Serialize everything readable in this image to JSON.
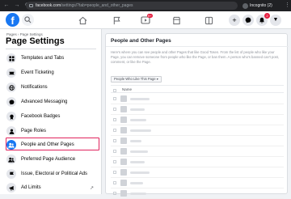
{
  "browser": {
    "url_domain": "facebook.com",
    "url_path": "/settings/?tab=people_and_other_pages",
    "profile_label": "Incognito (2)",
    "back_icon": "arrow-left-icon",
    "forward_icon": "arrow-right-icon",
    "reload_icon": "reload-icon"
  },
  "fb_header": {
    "logo": "f",
    "nav_badge": "9+",
    "plus_icon": "+",
    "messenger_badge": "",
    "notif_badge": "2",
    "accent": "#1877f2"
  },
  "sidebar": {
    "breadcrumb": "Pages › Page Settings",
    "title": "Page Settings",
    "items": [
      {
        "label": "Templates and Tabs",
        "icon": "grid-icon"
      },
      {
        "label": "Event Ticketing",
        "icon": "ticket-icon"
      },
      {
        "label": "Notifications",
        "icon": "globe-icon"
      },
      {
        "label": "Advanced Messaging",
        "icon": "messenger-icon"
      },
      {
        "label": "Facebook Badges",
        "icon": "badge-icon"
      },
      {
        "label": "Page Roles",
        "icon": "user-icon"
      },
      {
        "label": "People and Other Pages",
        "icon": "people-icon"
      },
      {
        "label": "Preferred Page Audience",
        "icon": "users-icon"
      },
      {
        "label": "Issue, Electoral or Political Ads",
        "icon": "flag-icon"
      },
      {
        "label": "Ad Limits",
        "icon": "megaphone-icon"
      }
    ],
    "active_index": 6
  },
  "main": {
    "title": "People and Other Pages",
    "description": "Here's where you can see people and other Pages that like Good Tosen. From the list of people who like your Page, you can remove someone from people who like the Page, or ban them. A person who's banned can't post, comment, or like the Page.",
    "filter_label": "People Who Like This Page ▾",
    "column_name": "Name",
    "rows": [
      {
        "name_hidden": ""
      },
      {
        "name_hidden": ""
      },
      {
        "name_hidden": ""
      },
      {
        "name_hidden": ""
      },
      {
        "name_hidden": ""
      },
      {
        "name_hidden": ""
      },
      {
        "name_hidden": ""
      },
      {
        "name_hidden": ""
      },
      {
        "name_hidden": ""
      },
      {
        "name_hidden": ""
      }
    ]
  }
}
